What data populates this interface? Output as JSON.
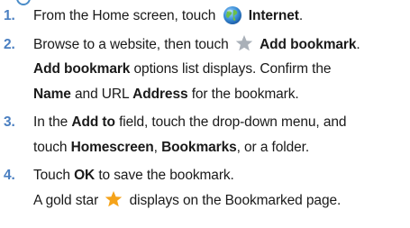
{
  "steps": [
    {
      "number": "1.",
      "pre": "From the Home screen, touch",
      "icon": "internet-globe-icon",
      "bold": "Internet",
      "post": "."
    },
    {
      "number": "2.",
      "pre": "Browse to a website, then touch",
      "icon": "gray-star-icon",
      "bold": "Add bookmark",
      "post": ".",
      "line2_bold1": "Add bookmark",
      "line2_text1": " options list displays. Confirm the",
      "line3_bold1": "Name",
      "line3_text1": " and URL ",
      "line3_bold2": "Address",
      "line3_text2": " for the bookmark."
    },
    {
      "number": "3.",
      "pre": "In the ",
      "bold1": "Add to",
      "mid": " field, touch the drop-down menu, and",
      "line2_pre": "touch ",
      "bold2": "Homescreen",
      "sep1": ", ",
      "bold3": "Bookmarks",
      "post": ", or a folder."
    },
    {
      "number": "4.",
      "pre": "Touch ",
      "bold": "OK",
      "post": " to save the bookmark.",
      "line2_pre": "A gold star",
      "icon": "gold-star-icon",
      "line2_post": "displays on the Bookmarked page."
    }
  ],
  "colors": {
    "step_number": "#4a7fc1",
    "gold_star": "#f5a31a",
    "gray_star": "#a9b0b8"
  }
}
